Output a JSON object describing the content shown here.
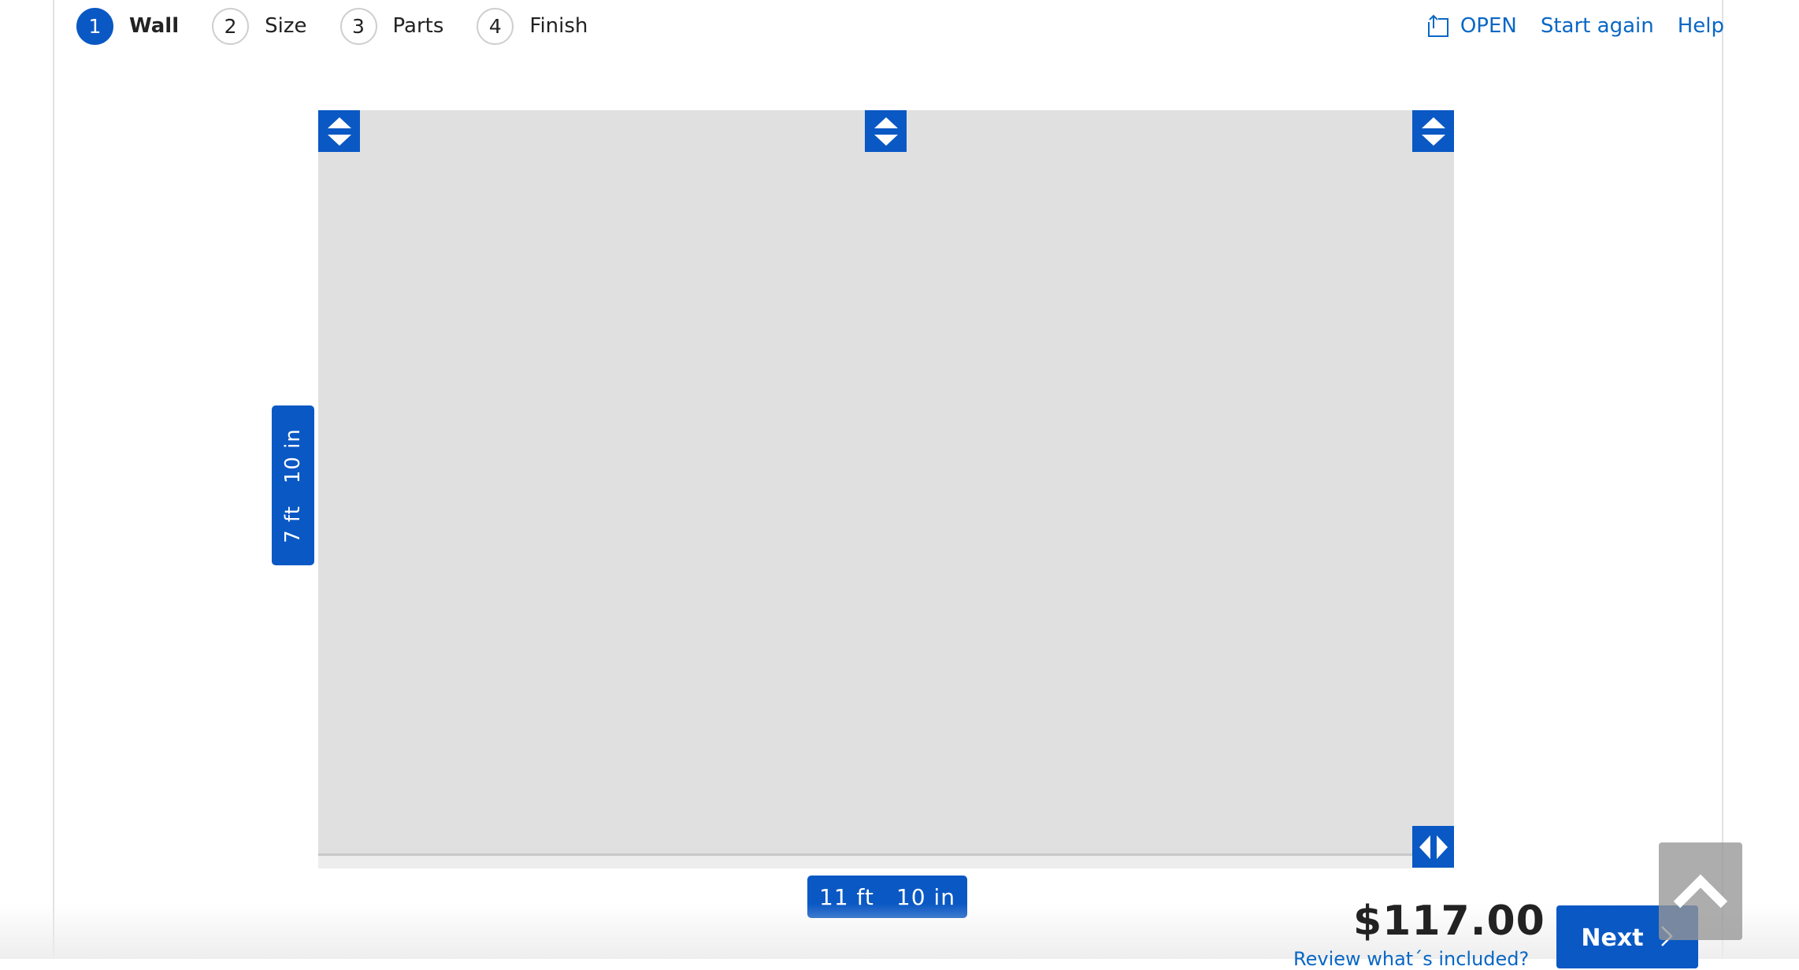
{
  "steps": [
    {
      "number": "1",
      "label": "Wall",
      "active": true
    },
    {
      "number": "2",
      "label": "Size",
      "active": false
    },
    {
      "number": "3",
      "label": "Parts",
      "active": false
    },
    {
      "number": "4",
      "label": "Finish",
      "active": false
    }
  ],
  "top_links": {
    "open": "OPEN",
    "start_again": "Start again",
    "help": "Help"
  },
  "wall": {
    "height": {
      "feet": "7 ft",
      "inches": "10 in"
    },
    "width": {
      "feet": "11 ft",
      "inches": "10 in"
    }
  },
  "footer": {
    "price": "$117.00",
    "review_link": "Review what´s included?",
    "next": "Next"
  },
  "icons": {
    "open": "open-folder-icon",
    "height_handle": "up-down-arrows-icon",
    "width_handle": "left-right-arrows-icon",
    "next": "chevron-right-icon",
    "scroll_top": "chevron-up-icon"
  },
  "colors": {
    "accent": "#0a58c4",
    "link": "#0a67c4",
    "wall": "#e0e0e0"
  }
}
